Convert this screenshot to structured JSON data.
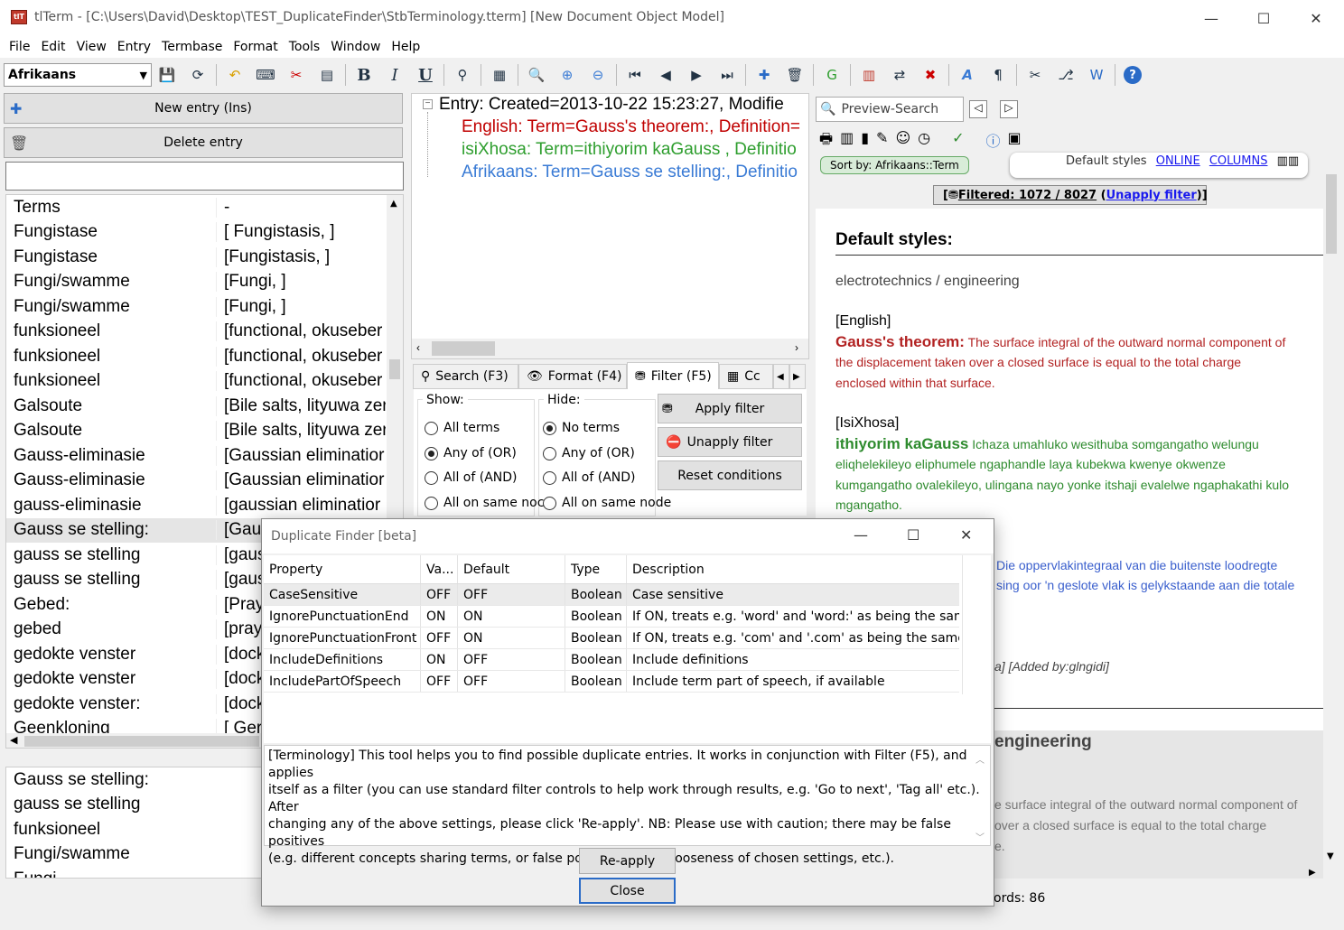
{
  "window": {
    "title": "tlTerm - [C:\\Users\\David\\Desktop\\TEST_DuplicateFinder\\StbTerminology.tterm] [New Document Object Model]",
    "minimize": "—",
    "maximize": "☐",
    "close": "✕"
  },
  "menu": [
    "File",
    "Edit",
    "View",
    "Entry",
    "Termbase",
    "Format",
    "Tools",
    "Window",
    "Help"
  ],
  "toolbar": {
    "language": "Afrikaans",
    "bold": "B",
    "italic": "I",
    "underline": "U"
  },
  "left": {
    "new_entry": "New entry (Ins)",
    "delete_entry": "Delete entry",
    "search_value": "",
    "header": {
      "term": "Terms",
      "def": "-"
    },
    "rows": [
      {
        "term": "Fungistase",
        "def": "[  Fungistasis, ]"
      },
      {
        "term": "Fungistase",
        "def": "[Fungistasis, ]"
      },
      {
        "term": "Fungi/swamme",
        "def": "[Fungi, ]"
      },
      {
        "term": "Fungi/swamme",
        "def": "[Fungi, ]"
      },
      {
        "term": "funksioneel",
        "def": "[functional, okuseber"
      },
      {
        "term": "funksioneel",
        "def": "[functional, okuseber"
      },
      {
        "term": "funksioneel",
        "def": "[functional, okuseber"
      },
      {
        "term": "Galsoute",
        "def": "[Bile salts, lityuwa zer"
      },
      {
        "term": "Galsoute",
        "def": "[Bile salts, lityuwa zer"
      },
      {
        "term": "Gauss-eliminasie",
        "def": "[Gaussian eliminatior"
      },
      {
        "term": "Gauss-eliminasie",
        "def": "[Gaussian eliminatior"
      },
      {
        "term": "gauss-eliminasie",
        "def": "[gaussian eliminatior"
      },
      {
        "term": "Gauss se stelling:",
        "def": "[Gau"
      },
      {
        "term": "gauss se stelling",
        "def": "[gaus"
      },
      {
        "term": "gauss se stelling",
        "def": "[gaus"
      },
      {
        "term": "Gebed:",
        "def": "[Pray"
      },
      {
        "term": "gebed",
        "def": "[pray"
      },
      {
        "term": "gedokte venster",
        "def": "[dock"
      },
      {
        "term": "gedokte venster",
        "def": "[dock"
      },
      {
        "term": "gedokte venster:",
        "def": "[dock"
      },
      {
        "term": "Geenkloning",
        "def": "[  Ger"
      }
    ],
    "dup_list": [
      "Gauss se stelling:",
      "gauss se stelling",
      "funksioneel",
      "Fungi/swamme",
      "Fungi..."
    ]
  },
  "tree": {
    "entry": "Entry:   Created=2013-10-22 15:23:27, Modifie",
    "english": "English:  Term=Gauss's theorem:, Definition=",
    "xhosa": "isiXhosa:  Term=ithiyorim kaGauss , Definitio",
    "afrikaans": "Afrikaans:  Term=Gauss se stelling:, Definitio",
    "colors": {
      "english": "#c00000",
      "xhosa": "#2e9e2e",
      "afrikaans": "#3a7bd5"
    }
  },
  "tabs": {
    "search": "Search (F3)",
    "format": "Format (F4)",
    "filter": "Filter (F5)",
    "col": "Cc"
  },
  "filter": {
    "show_label": "Show:",
    "hide_label": "Hide:",
    "show_opts": [
      "All terms",
      "Any of (OR)",
      "All of (AND)",
      "All on same noc"
    ],
    "hide_opts": [
      "No terms",
      "Any of (OR)",
      "All of (AND)",
      "All on same node"
    ],
    "apply": "Apply filter",
    "unapply": "Unapply filter",
    "reset": "Reset conditions"
  },
  "right": {
    "search_placeholder": "Preview-Search",
    "sort_by": "Sort by: Afrikaans::Term",
    "default_styles_link": "Default styles",
    "online": "ONLINE",
    "columns": "COLUMNS",
    "filtered_label": "Filtered: 1072 / 8027",
    "unapply_link": "Unapply filter",
    "heading": "Default styles:",
    "domain": "electrotechnics / engineering",
    "en_tag": "[English]",
    "en_term": "Gauss's theorem:",
    "en_def1": "The surface integral of the outward normal component of",
    "en_def2": "the  displacement  taken  over  a  closed  surface  is  equal  to  the  total  charge",
    "en_def3": "enclosed within that surface.",
    "xh_tag": "[IsiXhosa]",
    "xh_term": "ithiyorim  kaGauss",
    "xh_def1": "Ichaza  umahluko  wesithuba  somgangatho  welungu",
    "xh_def2": "eliqhelekileyo     eliphumele     ngaphandle     laya     kubekwa     kwenye     okwenze",
    "xh_def3": "kumgangatho ovalekileyo, ulingana nayo yonke itshaji evalelwe ngaphakathi kulo",
    "xh_def4": "mgangatho.",
    "af_def1": "Die  oppervlakintegraal  van  die  buitenste  loodregte",
    "af_def2": "sing oor 'n geslote vlak is gelykstaande aan die totale",
    "added_by": "a] [Added by:glngidi]",
    "section2": "engineering",
    "p2_1": "e surface integral of the outward normal component of",
    "p2_2": "over  a  closed  surface  is  equal  to  the  total  charge",
    "p2_3": "e.",
    "records": "ords: 86",
    "colors": {
      "en": "#b22222",
      "xh": "#2e8b2e",
      "af": "#3a5fcd",
      "link": "#1a1aee"
    }
  },
  "dialog": {
    "title": "Duplicate Finder [beta]",
    "columns": [
      "Property",
      "Va...",
      "Default",
      "Type",
      "Description"
    ],
    "rows": [
      {
        "property": "CaseSensitive",
        "value": "OFF",
        "default": "OFF",
        "type": "Boolean",
        "description": "Case sensitive"
      },
      {
        "property": "IgnorePunctuationEnd",
        "value": "ON",
        "default": "ON",
        "type": "Boolean",
        "description": "If ON, treats e.g. 'word' and 'word:' as being the same"
      },
      {
        "property": "IgnorePunctuationFront",
        "value": "OFF",
        "default": "ON",
        "type": "Boolean",
        "description": "If ON, treats e.g. 'com' and '.com' as being the same"
      },
      {
        "property": "IncludeDefinitions",
        "value": "ON",
        "default": "OFF",
        "type": "Boolean",
        "description": "Include definitions"
      },
      {
        "property": "IncludePartOfSpeech",
        "value": "OFF",
        "default": "OFF",
        "type": "Boolean",
        "description": "Include term part of speech, if available"
      }
    ],
    "description": "[Terminology] This tool helps you to find possible duplicate entries. It works in conjunction with Filter (F5), and applies\nitself as a filter (you can use standard filter controls to help work through results, e.g. 'Go to next', 'Tag all' etc.). After\nchanging any of the above settings, please click 'Re-apply'. NB: Please use with caution; there may be false positives\n(e.g. different concepts sharing terms, or false positives due to looseness of chosen settings, etc.).",
    "reapply": "Re-apply",
    "close": "Close"
  }
}
